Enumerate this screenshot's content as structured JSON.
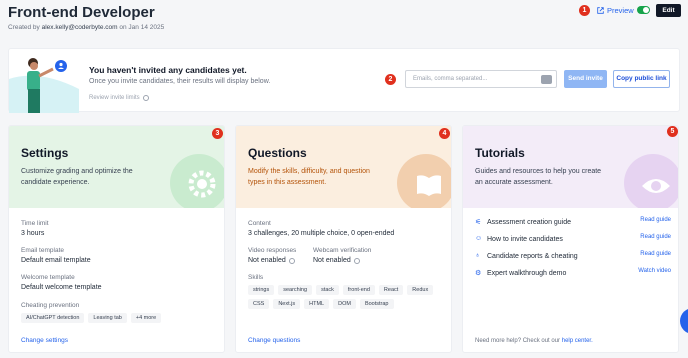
{
  "header": {
    "title": "Front-end Developer",
    "created_prefix": "Created by",
    "created_by": "alex.kelly@coderbyte.com",
    "created_on": "on Jan 14 2025",
    "preview_label": "Preview",
    "edit_label": "Edit"
  },
  "badges": [
    "1",
    "2",
    "3",
    "4",
    "5"
  ],
  "invite": {
    "heading": "You haven't invited any candidates yet.",
    "subtext": "Once you invite candidates, their results will display below.",
    "review_limits": "Review invite limits",
    "email_placeholder": "Emails, comma separated...",
    "send_label": "Send invite",
    "public_link_label": "Copy public link"
  },
  "settings": {
    "title": "Settings",
    "description": "Customize grading and optimize the candidate experience.",
    "time_limit_label": "Time limit",
    "time_limit_value": "3 hours",
    "email_template_label": "Email template",
    "email_template_value": "Default email template",
    "welcome_template_label": "Welcome template",
    "welcome_template_value": "Default welcome template",
    "cheating_label": "Cheating prevention",
    "cheating_chips": [
      "AI/ChatGPT detection",
      "Leaving tab",
      "+4 more"
    ],
    "change_label": "Change settings"
  },
  "questions": {
    "title": "Questions",
    "description": "Modify the skills, difficulty, and question types in this assessment.",
    "content_label": "Content",
    "content_value": "3 challenges, 20 multiple choice, 0 open-ended",
    "video_label": "Video responses",
    "video_value": "Not enabled",
    "webcam_label": "Webcam verification",
    "webcam_value": "Not enabled",
    "skills_label": "Skills",
    "skills": [
      "strings",
      "searching",
      "stack",
      "front-end",
      "React",
      "Redux",
      "CSS",
      "Next.js",
      "HTML",
      "DOM",
      "Bootstrap"
    ],
    "change_label": "Change questions"
  },
  "tutorials": {
    "title": "Tutorials",
    "description": "Guides and resources to help you create an accurate assessment.",
    "items": [
      {
        "label": "Assessment creation guide",
        "action": "Read guide",
        "icon": "sliders-icon"
      },
      {
        "label": "How to invite candidates",
        "action": "Read guide",
        "icon": "user-icon"
      },
      {
        "label": "Candidate reports & cheating",
        "action": "Read guide",
        "icon": "award-icon"
      },
      {
        "label": "Expert walkthrough demo",
        "action": "Watch video",
        "icon": "gear-icon"
      }
    ],
    "footer_text": "Need more help? Check out our",
    "footer_link": "help center."
  },
  "colors": {
    "accent": "#2563eb",
    "badge": "#e0301e",
    "settings_bg": "#e4f4e6",
    "questions_bg": "#fbeedf",
    "tutorials_bg": "#f3ecf8"
  }
}
